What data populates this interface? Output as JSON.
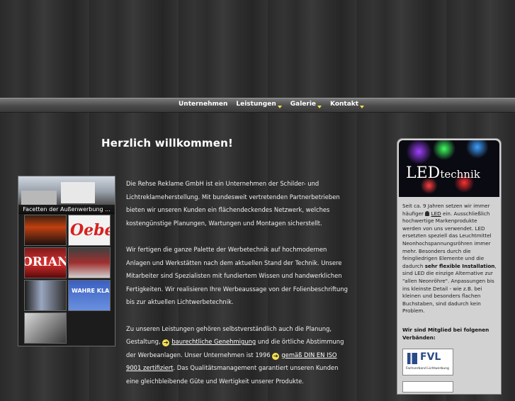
{
  "nav": {
    "items": [
      {
        "label": "Unternehmen",
        "has_dropdown": false
      },
      {
        "label": "Leistungen",
        "has_dropdown": true
      },
      {
        "label": "Galerie",
        "has_dropdown": true
      },
      {
        "label": "Kontakt",
        "has_dropdown": true
      }
    ]
  },
  "main": {
    "headline": "Herzlich willkommen!",
    "gallery": {
      "caption": "Facetten der Außenwerbung ...",
      "thumb_texts": [
        "Oebel",
        "ORIAN",
        "WAHRE KLASSE BIS IN DE"
      ]
    },
    "paragraphs": {
      "p1": "Die Rehse Reklame GmbH ist ein Unternehmen der Schilder- und Lichtreklameherstellung. Mit bundesweit vertretenden Partnerbetrieben bieten wir unseren Kunden ein flächendeckendes Netzwerk, welches kostengünstige Planungen, Wartungen und Montagen sicherstellt.",
      "p2": "Wir fertigen die ganze Palette der Werbetechnik auf hochmodernen Anlagen und Werkstätten nach dem aktuellen Stand der Technik. Unsere Mitarbeiter sind Spezialisten mit fundiertem Wissen und handwerklichen Fertigkeiten. Wir realisieren Ihre Werbeaussage von der Folienbeschriftung bis zur aktuellen Lichtwerbetechnik.",
      "p3_a": "Zu unseren Leistungen gehören selbstverständlich auch die Planung, Gestaltung,",
      "p3_link1": "baurechtliche Genehmigung",
      "p3_b": "und die örtliche Abstimmung der Werbeanlagen. Unser Unternehmen ist 1996",
      "p3_link2": "gemäß DIN EN ISO 9001 zertifiziert",
      "p3_c": ". Das Qualitätsmanagement garantiert unseren Kunden eine gleichbleibende Güte und Wertigkeit unserer Produkte."
    }
  },
  "sidebar": {
    "banner_title_big": "LED",
    "banner_title_small": "technik",
    "text_a": "Seit ca. 9 Jahren setzen wir immer häufiger",
    "led_link": "LED",
    "text_b": "ein. Ausschließlich hochwertige Markenprodukte werden von uns verwendet. LED ersetzten speziell das Leuchtmittel Neonhochspannungsröhren immer mehr. Besonders durch die feingliedrigen Elemente und die dadurch",
    "highlight": "sehr flexible Installation",
    "text_c": ", sind LED die einzige Alternative zur \"allen Neonröhre\". Anpassungen bis ins kleinste Detail - wie z.B. bei kleinen und besonders flachen Buchstaben, sind dadurch kein Problem.",
    "members_label": "Wir sind Mitglied bei folgenen Verbänden:",
    "fvl_logo_text": "FVL",
    "fvl_logo_sub": "Fachverband Lichtwerbung"
  },
  "colors": {
    "accent": "#f3e050",
    "nav_text": "#ffffff",
    "body_text": "#f0f0f0",
    "sidebar_bg": "#d2d2d2"
  }
}
